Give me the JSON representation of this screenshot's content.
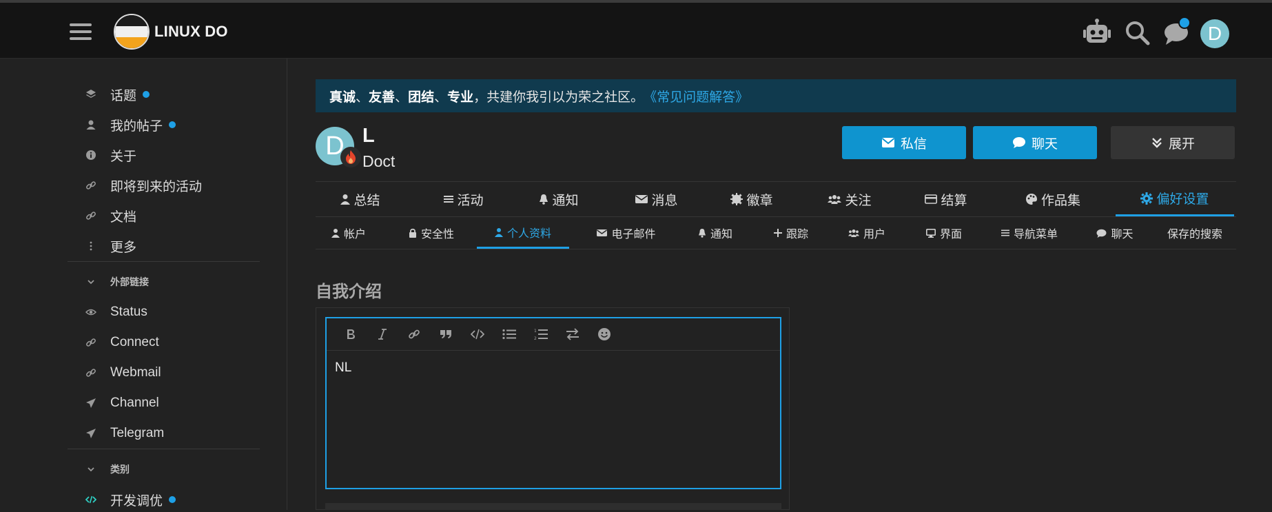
{
  "header": {
    "logo_text": "LINUX DO",
    "avatar_letter": "D",
    "icons": [
      "menu-icon",
      "robot-icon",
      "search-icon",
      "chat-bubble-icon"
    ]
  },
  "sidebar": {
    "items": [
      {
        "label": "话题",
        "icon": "layers-icon",
        "dot": true
      },
      {
        "label": "我的帖子",
        "icon": "user-icon",
        "dot": true
      },
      {
        "label": "关于",
        "icon": "info-icon",
        "dot": false
      },
      {
        "label": "即将到来的活动",
        "icon": "link-icon",
        "dot": false
      },
      {
        "label": "文档",
        "icon": "link-icon",
        "dot": false
      },
      {
        "label": "更多",
        "icon": "more-vertical-icon",
        "dot": false
      }
    ],
    "external_section": "外部链接",
    "external_links": [
      {
        "label": "Status",
        "icon": "eye-icon"
      },
      {
        "label": "Connect",
        "icon": "link-icon"
      },
      {
        "label": "Webmail",
        "icon": "link-icon"
      },
      {
        "label": "Channel",
        "icon": "paper-plane-icon"
      },
      {
        "label": "Telegram",
        "icon": "paper-plane-icon"
      }
    ],
    "categories_section": "类别",
    "categories": [
      {
        "label": "开发调优",
        "icon": "code-icon",
        "dot": true,
        "color": "#2fd1c5"
      }
    ]
  },
  "banner": {
    "v1": "真诚",
    "sep1": "、",
    "v2": "友善",
    "sep2": "、",
    "v3": "团结",
    "sep3": "、",
    "v4": "专业",
    "text": "，共建你我引以为荣之社区。",
    "faq": "《常见问题解答》"
  },
  "profile": {
    "avatar_letter": "D",
    "username": "L",
    "full_name": "Doct",
    "buttons": {
      "message": "私信",
      "chat": "聊天",
      "expand": "展开"
    }
  },
  "primary_nav": [
    {
      "label": "总结",
      "icon": "user-icon"
    },
    {
      "label": "活动",
      "icon": "list-icon"
    },
    {
      "label": "通知",
      "icon": "bell-icon"
    },
    {
      "label": "消息",
      "icon": "envelope-icon"
    },
    {
      "label": "徽章",
      "icon": "certificate-icon"
    },
    {
      "label": "关注",
      "icon": "users-icon"
    },
    {
      "label": "结算",
      "icon": "credit-card-icon"
    },
    {
      "label": "作品集",
      "icon": "palette-icon"
    },
    {
      "label": "偏好设置",
      "icon": "gear-icon",
      "active": true
    }
  ],
  "secondary_nav": [
    {
      "label": "帐户",
      "icon": "user-icon"
    },
    {
      "label": "安全性",
      "icon": "lock-icon"
    },
    {
      "label": "个人资料",
      "icon": "user-icon",
      "active": true
    },
    {
      "label": "电子邮件",
      "icon": "envelope-icon"
    },
    {
      "label": "通知",
      "icon": "bell-icon"
    },
    {
      "label": "跟踪",
      "icon": "plus-icon"
    },
    {
      "label": "用户",
      "icon": "users-icon"
    },
    {
      "label": "界面",
      "icon": "desktop-icon"
    },
    {
      "label": "导航菜单",
      "icon": "list-icon"
    },
    {
      "label": "聊天",
      "icon": "chat-bubble-icon"
    },
    {
      "label": "保存的搜索",
      "icon": ""
    }
  ],
  "bio": {
    "title": "自我介绍",
    "content": "NL",
    "toolbar": [
      "bold-icon",
      "italic-icon",
      "link-icon",
      "quote-icon",
      "code-icon",
      "bullet-list-icon",
      "numbered-list-icon",
      "toggle-direction-icon",
      "emoji-icon"
    ]
  },
  "colors": {
    "accent": "#1ea0e6",
    "button_primary": "#0f94cf",
    "banner_bg": "#103a4e",
    "avatar": "#7cc3cf"
  }
}
